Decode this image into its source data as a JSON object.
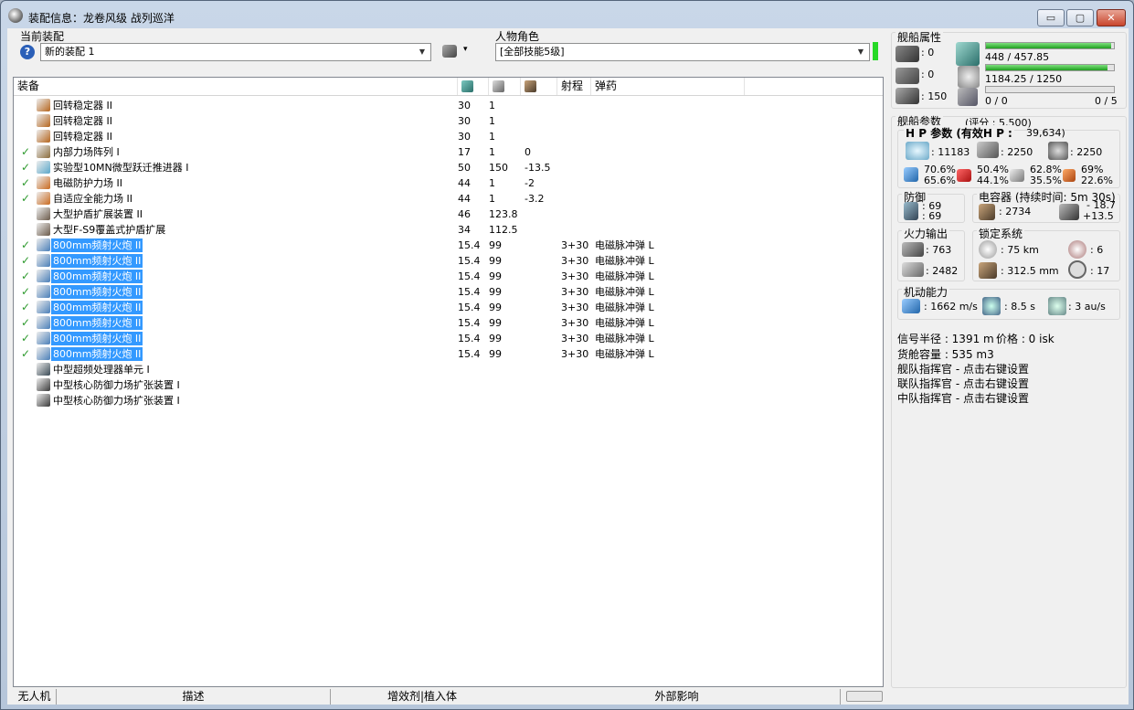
{
  "window": {
    "title": "装配信息：龙卷风级 战列巡洋",
    "min": "▭",
    "max": "▢",
    "close": "✕"
  },
  "fitting": {
    "label": "当前装配",
    "value": "新的装配  1",
    "help": "?",
    "tool": "▾"
  },
  "character": {
    "label": "人物角色",
    "value": "[全部技能5级]"
  },
  "columns": {
    "name": "装备",
    "range": "射程",
    "ammo": "弹药"
  },
  "modules": [
    {
      "check": "",
      "name": "回转稳定器 II",
      "a": "30",
      "b": "1",
      "c": "",
      "r": "",
      "ammo": "",
      "sel": false,
      "color": "#b5651d"
    },
    {
      "check": "",
      "name": "回转稳定器 II",
      "a": "30",
      "b": "1",
      "c": "",
      "r": "",
      "ammo": "",
      "sel": false,
      "color": "#b5651d"
    },
    {
      "check": "",
      "name": "回转稳定器 II",
      "a": "30",
      "b": "1",
      "c": "",
      "r": "",
      "ammo": "",
      "sel": false,
      "color": "#b5651d"
    },
    {
      "check": "✓",
      "name": "内部力场阵列 I",
      "a": "17",
      "b": "1",
      "c": "0",
      "r": "",
      "ammo": "",
      "sel": false,
      "color": "#8a6b3b"
    },
    {
      "check": "✓",
      "name": "实验型10MN微型跃迁推进器 I",
      "a": "50",
      "b": "150",
      "c": "-13.5",
      "r": "",
      "ammo": "",
      "sel": false,
      "color": "#5aa7c9"
    },
    {
      "check": "✓",
      "name": "电磁防护力场 II",
      "a": "44",
      "b": "1",
      "c": "-2",
      "r": "",
      "ammo": "",
      "sel": false,
      "color": "#c96a1f"
    },
    {
      "check": "✓",
      "name": "自适应全能力场 II",
      "a": "44",
      "b": "1",
      "c": "-3.2",
      "r": "",
      "ammo": "",
      "sel": false,
      "color": "#c96a1f"
    },
    {
      "check": "",
      "name": "大型护盾扩展装置 II",
      "a": "46",
      "b": "123.8",
      "c": "",
      "r": "",
      "ammo": "",
      "sel": false,
      "color": "#6b5a4a"
    },
    {
      "check": "",
      "name": "大型F-S9覆盖式护盾扩展",
      "a": "34",
      "b": "112.5",
      "c": "",
      "r": "",
      "ammo": "",
      "sel": false,
      "color": "#6b5a4a"
    },
    {
      "check": "✓",
      "name": "800mm频射火炮 II",
      "a": "15.4",
      "b": "99",
      "c": "",
      "r": "3+30",
      "ammo": "电磁脉冲弹 L",
      "sel": true,
      "color": "#4a7fb8"
    },
    {
      "check": "✓",
      "name": "800mm频射火炮 II",
      "a": "15.4",
      "b": "99",
      "c": "",
      "r": "3+30",
      "ammo": "电磁脉冲弹 L",
      "sel": true,
      "color": "#4a7fb8"
    },
    {
      "check": "✓",
      "name": "800mm频射火炮 II",
      "a": "15.4",
      "b": "99",
      "c": "",
      "r": "3+30",
      "ammo": "电磁脉冲弹 L",
      "sel": true,
      "color": "#4a7fb8"
    },
    {
      "check": "✓",
      "name": "800mm频射火炮 II",
      "a": "15.4",
      "b": "99",
      "c": "",
      "r": "3+30",
      "ammo": "电磁脉冲弹 L",
      "sel": true,
      "color": "#4a7fb8"
    },
    {
      "check": "✓",
      "name": "800mm频射火炮 II",
      "a": "15.4",
      "b": "99",
      "c": "",
      "r": "3+30",
      "ammo": "电磁脉冲弹 L",
      "sel": true,
      "color": "#4a7fb8"
    },
    {
      "check": "✓",
      "name": "800mm频射火炮 II",
      "a": "15.4",
      "b": "99",
      "c": "",
      "r": "3+30",
      "ammo": "电磁脉冲弹 L",
      "sel": true,
      "color": "#4a7fb8"
    },
    {
      "check": "✓",
      "name": "800mm频射火炮 II",
      "a": "15.4",
      "b": "99",
      "c": "",
      "r": "3+30",
      "ammo": "电磁脉冲弹 L",
      "sel": true,
      "color": "#4a7fb8"
    },
    {
      "check": "✓",
      "name": "800mm频射火炮 II",
      "a": "15.4",
      "b": "99",
      "c": "",
      "r": "3+30",
      "ammo": "电磁脉冲弹 L",
      "sel": true,
      "color": "#4a7fb8"
    },
    {
      "check": "",
      "name": "中型超频处理器单元 I",
      "a": "",
      "b": "",
      "c": "",
      "r": "",
      "ammo": "",
      "sel": false,
      "color": "#3a4a55"
    },
    {
      "check": "",
      "name": "中型核心防御力场扩张装置 I",
      "a": "",
      "b": "",
      "c": "",
      "r": "",
      "ammo": "",
      "sel": false,
      "color": "#3a3a3a"
    },
    {
      "check": "",
      "name": "中型核心防御力场扩张装置 I",
      "a": "",
      "b": "",
      "c": "",
      "r": "",
      "ammo": "",
      "sel": false,
      "color": "#3a3a3a"
    }
  ],
  "status_bar": {
    "drones": "无人机",
    "desc": "描述",
    "boosters": "增效剂|植入体",
    "external": "外部影响"
  },
  "ship": {
    "title": "舰船属性",
    "hi": ": 0",
    "mid": ": 0",
    "lo": ": 150",
    "cpu": "448 / 457.85",
    "cpu_pct": 0.98,
    "pg": "1184.25 / 1250",
    "pg_pct": 0.947,
    "calib": "0 / 0",
    "calib2": "0 / 5",
    "calib_pct": 0
  },
  "params": {
    "title": "舰船参数",
    "score": "(评分 : 5,500)"
  },
  "hp": {
    "title": "H P 参数 (有效H P :",
    "ehp": "39,634)",
    "shield": ": 11183",
    "armor": ": 2250",
    "structure": ": 2250",
    "r1a": "70.6%",
    "r1b": "65.6%",
    "r2a": "50.4%",
    "r2b": "44.1%",
    "r3a": "62.8%",
    "r3b": "35.5%",
    "r4a": "69%",
    "r4b": "22.6%"
  },
  "defense": {
    "title": "防御",
    "a": ": 69",
    "b": ": 69"
  },
  "cap": {
    "title": "电容器 (持续时间: 5m 30s)",
    "val": ": 2734",
    "d1": "- 18.7",
    "d2": "+13.5"
  },
  "fire": {
    "title": "火力输出",
    "a": ": 763",
    "b": ": 2482"
  },
  "lock": {
    "title": "锁定系统",
    "range": ": 75 km",
    "targets": ": 6",
    "scan": ": 312.5 mm",
    "sens": ": 17"
  },
  "nav": {
    "title": "机动能力",
    "speed": ": 1662 m/s",
    "align": ": 8.5 s",
    "warp": ": 3 au/s"
  },
  "misc": {
    "sig": "信号半径 : 1391 m",
    "price": "价格 : 0 isk",
    "cargo": "货舱容量 : 535 m3",
    "fleet": "舰队指挥官 - 点击右键设置",
    "wing": "联队指挥官 - 点击右键设置",
    "squad": "中队指挥官 - 点击右键设置"
  }
}
